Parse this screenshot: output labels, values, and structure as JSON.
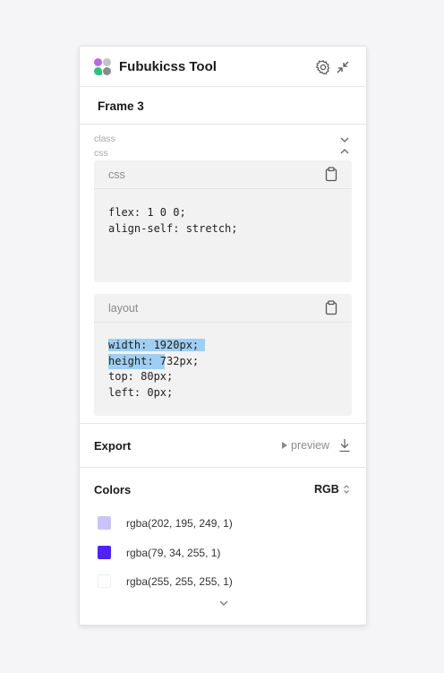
{
  "app": {
    "title": "Fubukicss Tool"
  },
  "frame": {
    "name": "Frame 3"
  },
  "sections": {
    "class_label": "class",
    "css_label": "css"
  },
  "css_card": {
    "title": "css",
    "lines": [
      "flex: 1 0 0;",
      "align-self: stretch;"
    ]
  },
  "layout_card": {
    "title": "layout",
    "lines": [
      "width: 1920px;",
      "height: 732px;",
      "top: 80px;",
      "left: 0px;"
    ]
  },
  "export": {
    "label": "Export",
    "preview_label": "preview"
  },
  "colors": {
    "label": "Colors",
    "mode": "RGB",
    "items": [
      {
        "value": "rgba(202, 195, 249, 1)",
        "hex": "#cac3f9"
      },
      {
        "value": "rgba(79, 34, 255, 1)",
        "hex": "#4f22ff"
      },
      {
        "value": "rgba(255, 255, 255, 1)",
        "hex": "#ffffff"
      }
    ]
  }
}
